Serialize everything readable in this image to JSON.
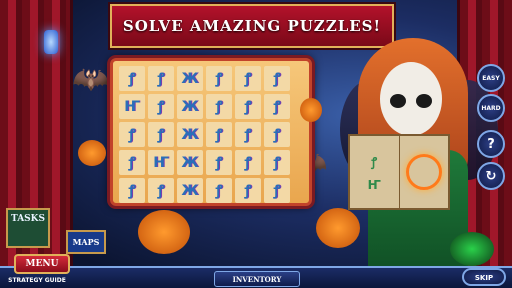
{
  "banner": {
    "title": "SOLVE AMAZING PUZZLES!"
  },
  "board": {
    "tiles": [
      [
        "ꝭ",
        "ꝭ",
        "Ж",
        "ꝭ",
        "ꝭ",
        "ꝭ"
      ],
      [
        "Ҥ",
        "ꝭ",
        "Ж",
        "ꝭ",
        "ꝭ",
        "ꝭ"
      ],
      [
        "ꝭ",
        "ꝭ",
        "Ж",
        "ꝭ",
        "ꝭ",
        "ꝭ"
      ],
      [
        "ꝭ",
        "Ҥ",
        "Ж",
        "ꝭ",
        "ꝭ",
        "ꝭ"
      ],
      [
        "ꝭ",
        "ꝭ",
        "Ж",
        "ꝭ",
        "ꝭ",
        "ꝭ"
      ]
    ]
  },
  "book": {
    "glyph_top": "ꝭ",
    "glyph_bottom": "Ҥ"
  },
  "side_buttons": {
    "easy": "EASY",
    "hard": "HARD",
    "hint_symbol": "?",
    "reset_symbol": "↻"
  },
  "bottom": {
    "tasks": "TASKS",
    "maps": "MAPS",
    "menu": "MENU",
    "strategy_guide": "STRATEGY GUIDE",
    "inventory": "INVENTORY",
    "skip": "SKIP"
  },
  "colors": {
    "banner": "#b3122b",
    "board": "#f6c77a",
    "accent": "#7fa7e6"
  }
}
